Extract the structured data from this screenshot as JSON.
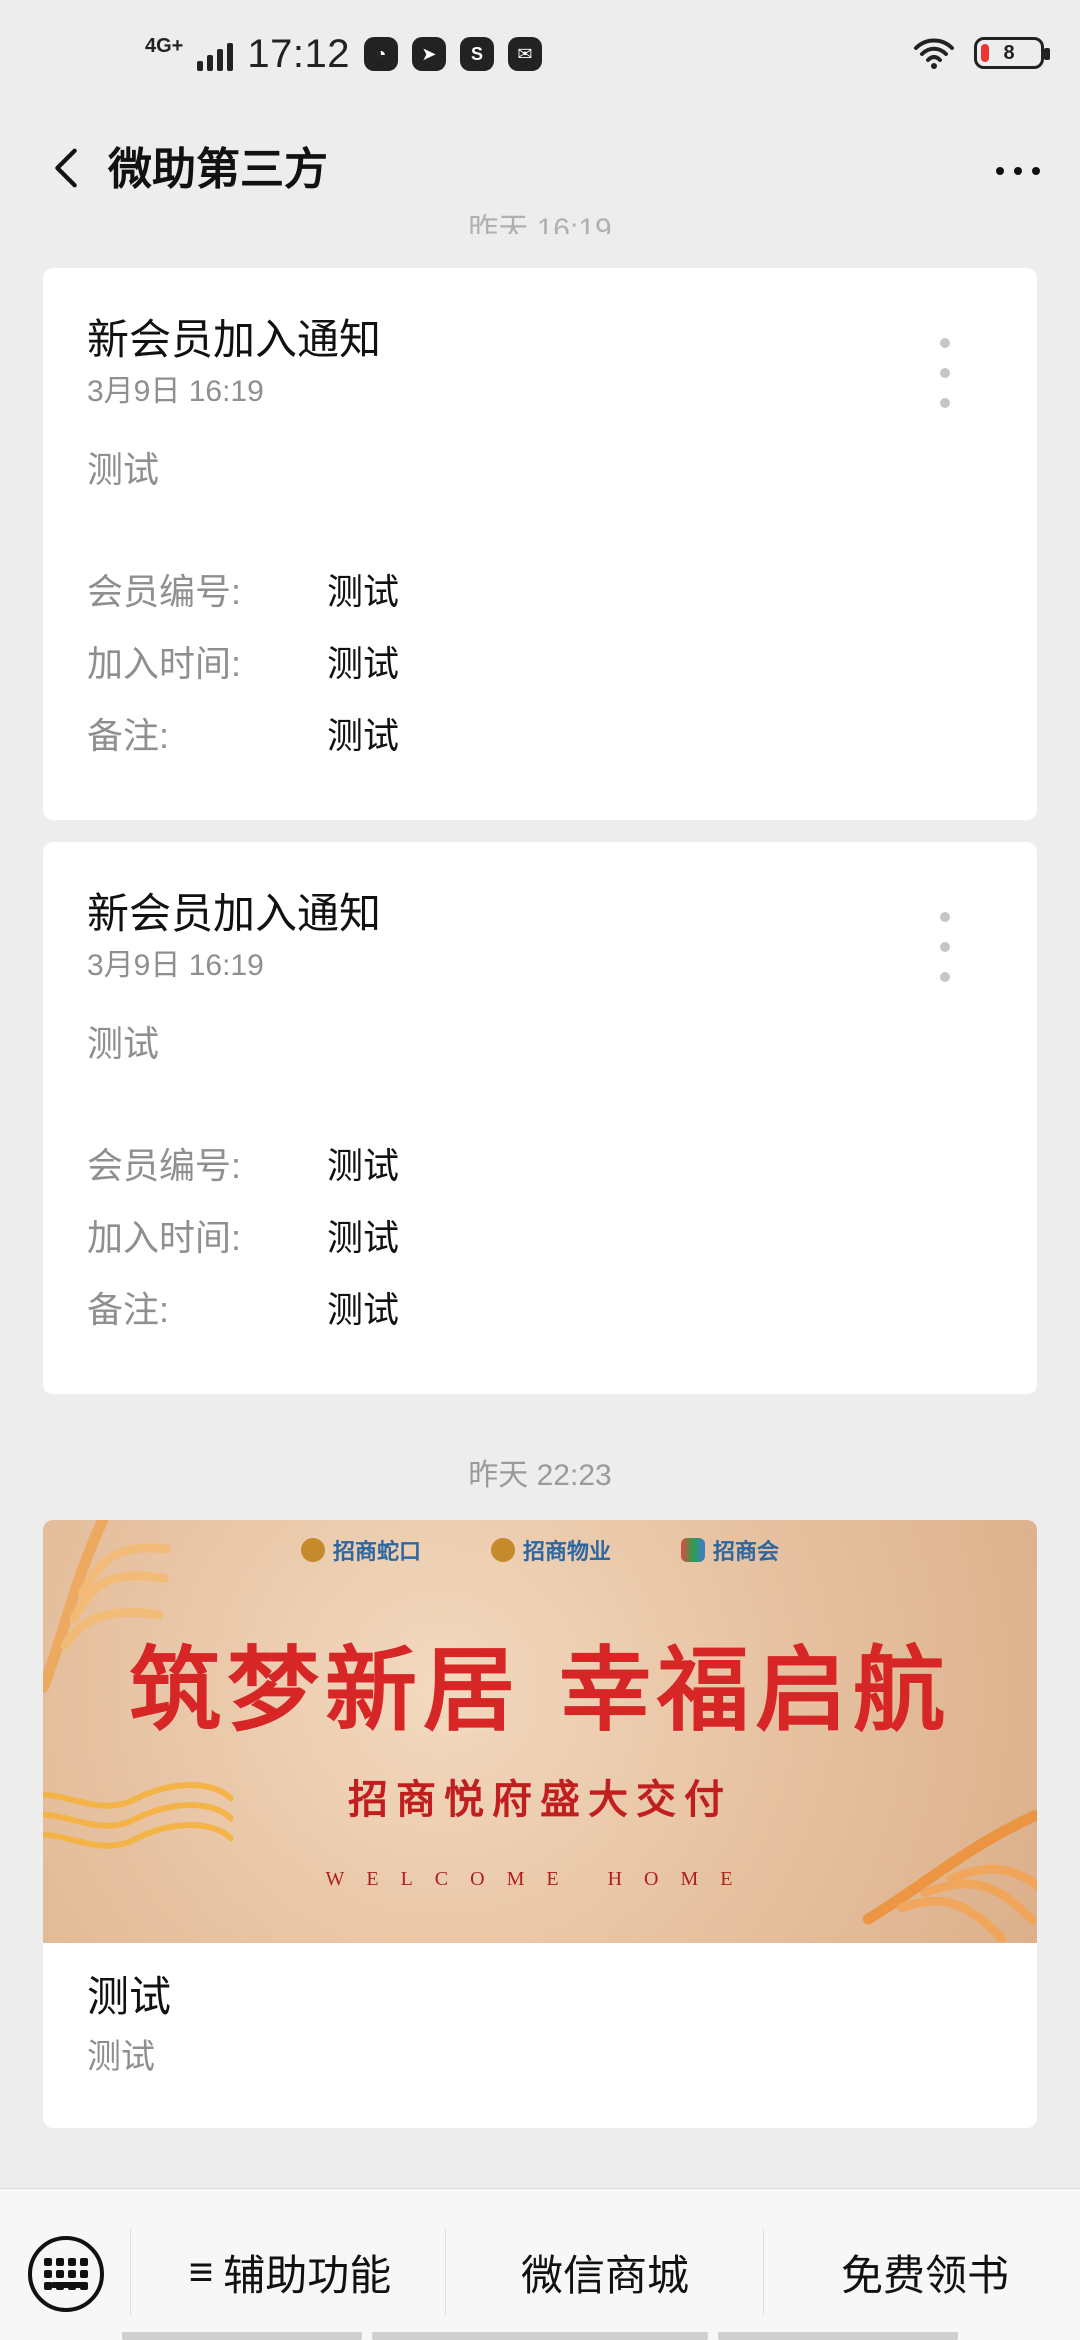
{
  "status_bar": {
    "network": "4G+",
    "time": "17:12",
    "battery": "8",
    "icons": [
      "bird-icon",
      "compass-icon",
      "s-app-icon",
      "mail-icon",
      "wifi-icon",
      "battery-icon"
    ]
  },
  "nav": {
    "title": "微助第三方",
    "back_icon": "chevron-left-icon",
    "more_icon": "more-dots-icon"
  },
  "top_cut_time": "昨天 16:19",
  "cards": [
    {
      "title": "新会员加入通知",
      "date": "3月9日  16:19",
      "first": "测试",
      "fields": [
        {
          "k": "会员编号:",
          "v": "测试"
        },
        {
          "k": "加入时间:",
          "v": "测试"
        },
        {
          "k": "备注:",
          "v": "测试"
        }
      ]
    },
    {
      "title": "新会员加入通知",
      "date": "3月9日  16:19",
      "first": "测试",
      "fields": [
        {
          "k": "会员编号:",
          "v": "测试"
        },
        {
          "k": "加入时间:",
          "v": "测试"
        },
        {
          "k": "备注:",
          "v": "测试"
        }
      ]
    }
  ],
  "timestamp": "昨天 22:23",
  "article": {
    "logos": [
      "招商蛇口",
      "招商物业",
      "招商会"
    ],
    "headline": "筑梦新居 幸福启航",
    "subheadline": "招商悦府盛大交付",
    "welcome": "WELCOME HOME",
    "title": "测试",
    "desc": "测试"
  },
  "bottom_menu": {
    "keyboard_icon": "keyboard-icon",
    "items": [
      {
        "prefix": "≡",
        "label": "辅助功能"
      },
      {
        "prefix": "",
        "label": "微信商城"
      },
      {
        "prefix": "",
        "label": "免费领书"
      }
    ]
  }
}
